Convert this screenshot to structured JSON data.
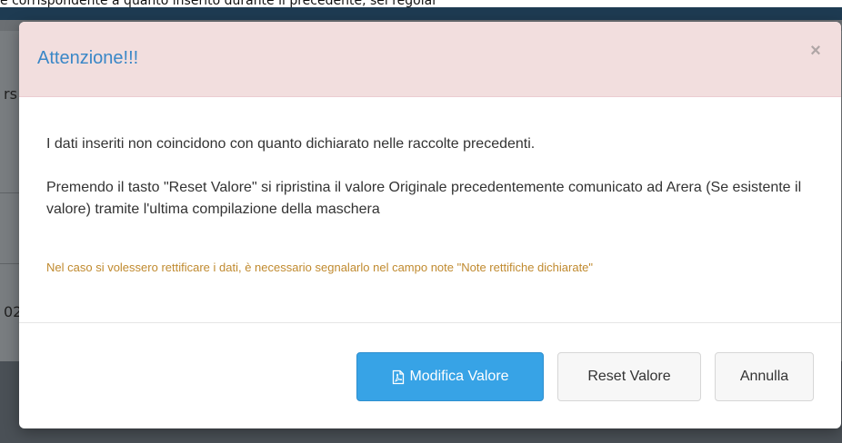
{
  "background": {
    "caption": "e corrispondente a quanto inserito durante il precedente, sei regolar",
    "fragments": [
      "rs",
      "02"
    ]
  },
  "modal": {
    "title": "Attenzione!!!",
    "close_symbol": "×",
    "message_1": "I dati inseriti non coincidono con quanto dichiarato nelle raccolte precedenti.",
    "message_2": "Premendo il tasto \"Reset Valore\" si ripristina il valore Originale precedentemente comunicato ad Arera (Se esistente il valore) tramite l'ultima compilazione della maschera",
    "note": "Nel caso si volessero rettificare i dati, è necessario segnalarlo nel campo note \"Note rettifiche dichiarate\"",
    "buttons": {
      "modify_label": "Modifica Valore",
      "modify_icon": "file-pdf-icon",
      "reset_label": "Reset Valore",
      "cancel_label": "Annulla"
    }
  },
  "colors": {
    "header_bg": "#f2dede",
    "title_color": "#3a87c7",
    "note_color": "#c08a2f",
    "primary_button": "#37a3e6"
  }
}
